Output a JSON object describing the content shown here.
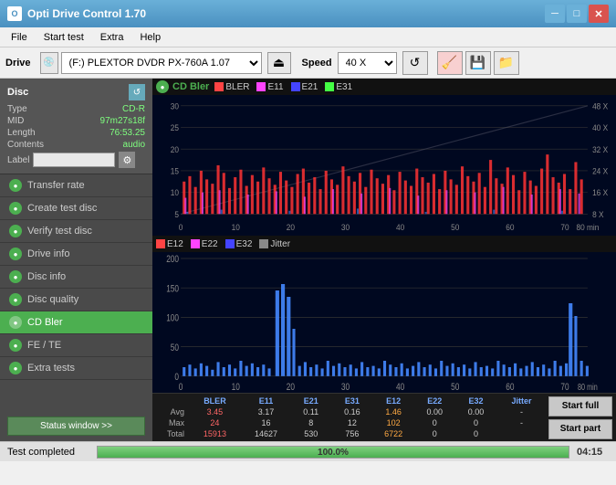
{
  "titleBar": {
    "title": "Opti Drive Control 1.70",
    "iconLabel": "O",
    "minBtn": "─",
    "maxBtn": "□",
    "closeBtn": "✕"
  },
  "menuBar": {
    "items": [
      "File",
      "Start test",
      "Extra",
      "Help"
    ]
  },
  "driveBar": {
    "label": "Drive",
    "driveValue": "(F:)  PLEXTOR DVDR  PX-760A 1.07",
    "speedLabel": "Speed",
    "speedValue": "40 X"
  },
  "sidebar": {
    "discTitle": "Disc",
    "discFields": [
      {
        "key": "Type",
        "value": "CD-R"
      },
      {
        "key": "MID",
        "value": "97m27s18f"
      },
      {
        "key": "Length",
        "value": "76:53.25"
      },
      {
        "key": "Contents",
        "value": "audio"
      },
      {
        "key": "Label",
        "value": ""
      }
    ],
    "navItems": [
      {
        "label": "Transfer rate",
        "active": false
      },
      {
        "label": "Create test disc",
        "active": false
      },
      {
        "label": "Verify test disc",
        "active": false
      },
      {
        "label": "Drive info",
        "active": false
      },
      {
        "label": "Disc info",
        "active": false
      },
      {
        "label": "Disc quality",
        "active": false
      },
      {
        "label": "CD Bler",
        "active": true
      },
      {
        "label": "FE / TE",
        "active": false
      },
      {
        "label": "Extra tests",
        "active": false
      }
    ],
    "statusBtn": "Status window >>"
  },
  "chart": {
    "title": "CD Bler",
    "topLegend": [
      {
        "label": "BLER",
        "color": "#ff4444"
      },
      {
        "label": "E11",
        "color": "#ff44ff"
      },
      {
        "label": "E21",
        "color": "#4444ff"
      },
      {
        "label": "E31",
        "color": "#44ff44"
      }
    ],
    "bottomLegend": [
      {
        "label": "E12",
        "color": "#ff4444"
      },
      {
        "label": "E22",
        "color": "#ff44ff"
      },
      {
        "label": "E32",
        "color": "#4444ff"
      },
      {
        "label": "Jitter",
        "color": "#888888"
      }
    ],
    "topYMax": 30,
    "topYLabels": [
      "30",
      "25",
      "20",
      "15",
      "10",
      "5",
      "0"
    ],
    "topYRight": [
      "48 X",
      "40 X",
      "32 X",
      "24 X",
      "16 X",
      "8 X"
    ],
    "bottomYMax": 200,
    "bottomYLabels": [
      "200",
      "150",
      "100",
      "50",
      "0"
    ],
    "xMax": 80,
    "xLabels": [
      "0",
      "10",
      "20",
      "30",
      "40",
      "50",
      "60",
      "70",
      "80 min"
    ]
  },
  "stats": {
    "headers": [
      "",
      "BLER",
      "E11",
      "E21",
      "E31",
      "E12",
      "E22",
      "E32",
      "Jitter"
    ],
    "rows": [
      {
        "label": "Avg",
        "values": [
          "3.45",
          "3.17",
          "0.11",
          "0.16",
          "1.46",
          "0.00",
          "0.00",
          "-"
        ]
      },
      {
        "label": "Max",
        "values": [
          "24",
          "16",
          "8",
          "12",
          "102",
          "0",
          "0",
          "-"
        ]
      },
      {
        "label": "Total",
        "values": [
          "15913",
          "14627",
          "530",
          "756",
          "6722",
          "0",
          "0",
          ""
        ]
      }
    ],
    "startFullBtn": "Start full",
    "startPartBtn": "Start part"
  },
  "statusBar": {
    "statusText": "Test completed",
    "progressValue": 100,
    "progressText": "100.0%",
    "timeText": "04:15"
  }
}
